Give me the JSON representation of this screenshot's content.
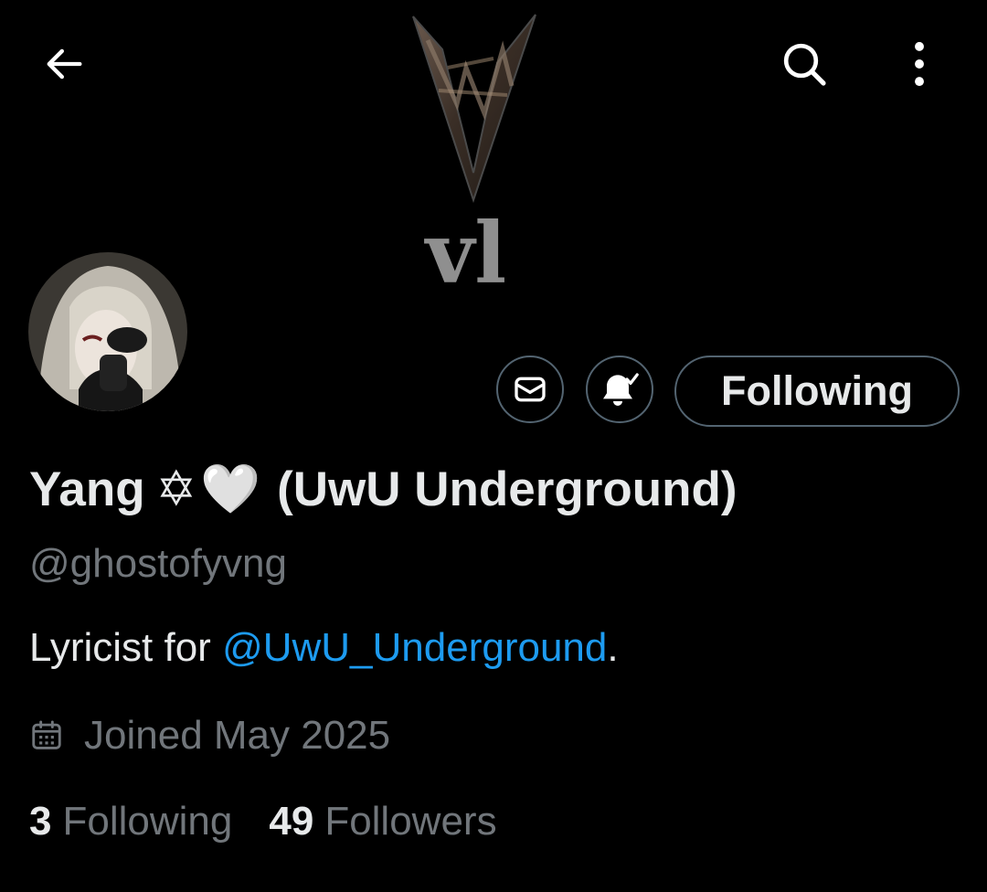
{
  "header": {
    "back_icon": "arrow-left-icon",
    "search_icon": "search-icon",
    "more_icon": "more-vertical-icon"
  },
  "banner": {
    "logo_text": "vl"
  },
  "actions": {
    "message_icon": "mail-icon",
    "notify_icon": "bell-check-icon",
    "follow_label": "Following"
  },
  "profile": {
    "display_name": "Yang",
    "name_glyph": "✡",
    "name_emoji": "🤍",
    "name_suffix": "(UwU Underground)",
    "handle": "@ghostofyvng",
    "bio_prefix": "Lyricist for ",
    "bio_mention": "@UwU_Underground",
    "bio_suffix": ".",
    "joined": "Joined May 2025"
  },
  "stats": {
    "following_count": "3",
    "following_label": "Following",
    "followers_count": "49",
    "followers_label": "Followers"
  },
  "colors": {
    "background": "#000000",
    "text_primary": "#e7e9ea",
    "text_secondary": "#71767b",
    "link": "#1d9bf0",
    "border": "#536471"
  }
}
